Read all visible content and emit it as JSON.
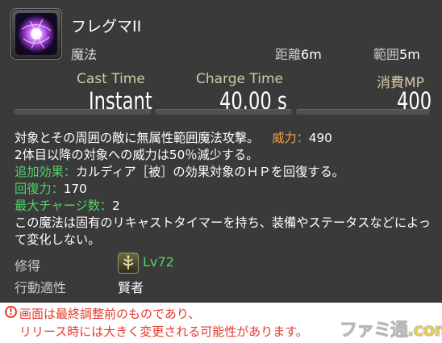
{
  "skill": {
    "name": "フレグマII",
    "type": "魔法",
    "range_label": "距離",
    "range_value": "6m",
    "radius_label": "範囲",
    "radius_value": "5m",
    "icon": "phlegma-orb-icon"
  },
  "stats": {
    "cast_label": "Cast Time",
    "cast_value": "Instant",
    "recast_label": "Charge Time",
    "recast_value": "40.00 s",
    "cost_label": "消費MP",
    "cost_value": "400"
  },
  "description": {
    "line1": "対象とその周囲の敵に無属性範囲魔法攻撃。",
    "potency_label": "威力",
    "potency_value": "490",
    "line2": "2体目以降の対象への威力は50％減少する。",
    "additional_label": "追加効果",
    "additional_text": "カルディア［被］の効果対象のＨＰを回復する。",
    "cure_label": "回復力",
    "cure_value": "170",
    "charges_label": "最大チャージ数",
    "charges_value": "2",
    "line3": "この魔法は固有のリキャストタイマーを持ち、装備やステータスなどによって変化しない。",
    "colon": "："
  },
  "meta": {
    "acquired_label": "修得",
    "level": "Lv72",
    "job_icon": "sage-job-icon",
    "affinity_label": "行動適性",
    "job": "賢者"
  },
  "notice": {
    "icon": "exclamation-icon",
    "icon_glyph": "!",
    "line1": "画面は最終調整前のものであり、",
    "line2": "リリース時には大きく変更される可能性があります。",
    "logo": "ファミ通.com"
  },
  "colors": {
    "background": "#3a3a3a",
    "label_gold": "#d2c8a8",
    "green": "#4fd36c",
    "orange": "#f3a33a",
    "notice_red": "#e33a2b"
  }
}
